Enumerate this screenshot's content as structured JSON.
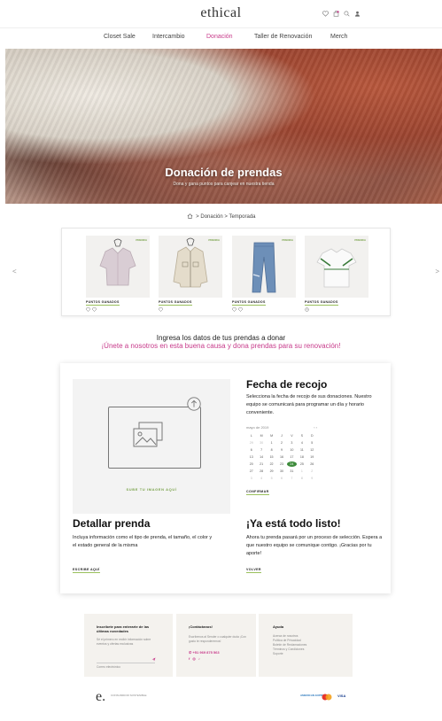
{
  "header": {
    "logo": "ethical",
    "icons": [
      "heart-icon",
      "bag-icon",
      "search-icon",
      "user-icon"
    ]
  },
  "nav": {
    "items": [
      "Closet Sale",
      "Intercambio",
      "Donación",
      "Taller de Renovación",
      "Merch"
    ],
    "active": "Donación",
    "active_color": "#c73a8a"
  },
  "hero": {
    "title": "Donación de prendas",
    "subtitle": "Dona y gana puntos para canjear en nuestra tienda"
  },
  "breadcrumb": {
    "items": [
      "Donación",
      "Temporada"
    ],
    "separator": ">"
  },
  "carousel": {
    "prev": "<",
    "next": ">",
    "products": [
      {
        "tag": "PRENDA",
        "points_label": "PUNTOS GANADOS",
        "kind": "blouse"
      },
      {
        "tag": "PRENDA",
        "points_label": "PUNTOS GANADOS",
        "kind": "jacket"
      },
      {
        "tag": "PRENDA",
        "points_label": "PUNTOS GANADOS",
        "kind": "jeans"
      },
      {
        "tag": "PRENDA",
        "points_label": "PUNTOS GANADOS",
        "kind": "tshirt"
      }
    ]
  },
  "intro": {
    "line1": "Ingresa los datos de tus prendas a donar",
    "line2": "¡Únete a nosotros en esta buena causa y dona prendas para su renovación!"
  },
  "upload": {
    "label": "SUBE TU IMAGEN AQUÍ"
  },
  "pickup": {
    "title": "Fecha de recojo",
    "text": "Selecciona la fecha de recojo de sus donaciones. Nuestro equipo se comunicará para programar un día y horario conveniente.",
    "month": "mayo de 2019",
    "nav": "‹ ›",
    "weekdays": [
      "L",
      "M",
      "M",
      "J",
      "V",
      "S",
      "D"
    ],
    "days": [
      "29",
      "30",
      "1",
      "2",
      "3",
      "4",
      "5",
      "6",
      "7",
      "8",
      "9",
      "10",
      "11",
      "12",
      "13",
      "14",
      "15",
      "16",
      "17",
      "18",
      "19",
      "20",
      "21",
      "22",
      "23",
      "24",
      "25",
      "26",
      "27",
      "28",
      "29",
      "30",
      "31",
      "1",
      "2",
      "3",
      "4",
      "5",
      "6",
      "7",
      "8",
      "9"
    ],
    "selected": "24",
    "confirm": "CONFIRMAR",
    "accent": "#3d8b3b"
  },
  "detail": {
    "title": "Detallar prenda",
    "text": "Incluya información como el tipo de prenda, el tamaño, el color y el estado general de la misma",
    "link": "ESCRIBE AQUÍ"
  },
  "done": {
    "title": "¡Ya está todo listo!",
    "text": "Ahora tu prenda pasará por un proceso de selección. Espera a que nuestro equipo se comunique contigo. ¡Gracias por tu aporte!",
    "link": "VOLVER"
  },
  "footer": {
    "newsletter": {
      "title": "Inscríbete para enterarte de las últimas novedades",
      "text": "Sé el primero en recibir información sobre eventos y ofertas exclusivas",
      "placeholder": "Correo electrónico"
    },
    "contact": {
      "title": "¡Contáctanos!",
      "text": "Escríbenos al Sender o cualquier duda ¡Con gusto te responderemos!",
      "phone": "+51 969 875 563"
    },
    "help": {
      "title": "Ayuda",
      "links": [
        "Acerca de nosotros",
        "Política de Privacidad",
        "Boletín de Reclamaciones",
        "Términos y Condiciones",
        "Soporte"
      ]
    },
    "logo": "e.",
    "brand_small": "CONSUMIDOR SOSTENIBLE",
    "payments": [
      "AMERICAN EXPRESS",
      "mastercard",
      "VISA"
    ]
  }
}
